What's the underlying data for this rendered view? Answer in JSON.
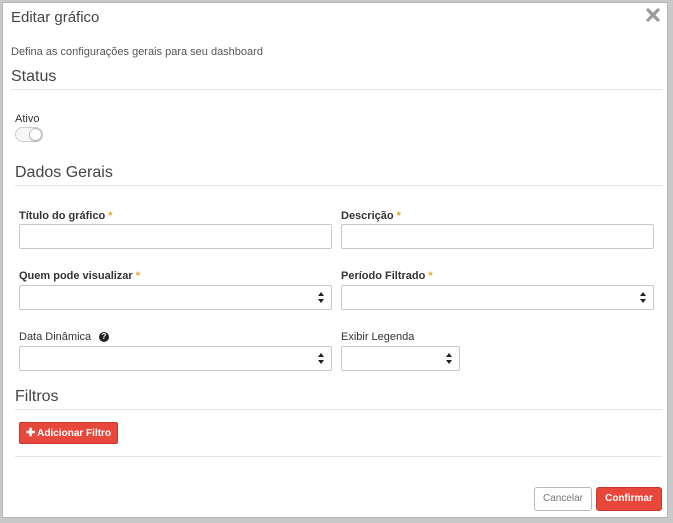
{
  "dialog": {
    "title": "Editar gráfico",
    "subtitle": "Defina as configurações gerais para seu dashboard",
    "close_icon": "close-icon"
  },
  "status": {
    "heading": "Status",
    "active_label": "Ativo",
    "active": false
  },
  "general": {
    "heading": "Dados Gerais",
    "chart_title_label": "Título do gráfico",
    "chart_title_value": "",
    "description_label": "Descrição",
    "description_value": "",
    "who_can_view_label": "Quem pode visualizar",
    "who_can_view_value": "",
    "filtered_period_label": "Período Filtrado",
    "filtered_period_value": "",
    "dynamic_date_label": "Data Dinâmica",
    "dynamic_date_value": "",
    "show_legend_label": "Exibir Legenda",
    "show_legend_value": "",
    "required_marker": "*"
  },
  "filters": {
    "heading": "Filtros",
    "add_button_label": "Adicionar Filtro",
    "add_icon": "plus-icon"
  },
  "footer": {
    "cancel_label": "Cancelar",
    "confirm_label": "Confirmar"
  },
  "colors": {
    "primary": "#e8473b",
    "required": "#f0a020"
  }
}
